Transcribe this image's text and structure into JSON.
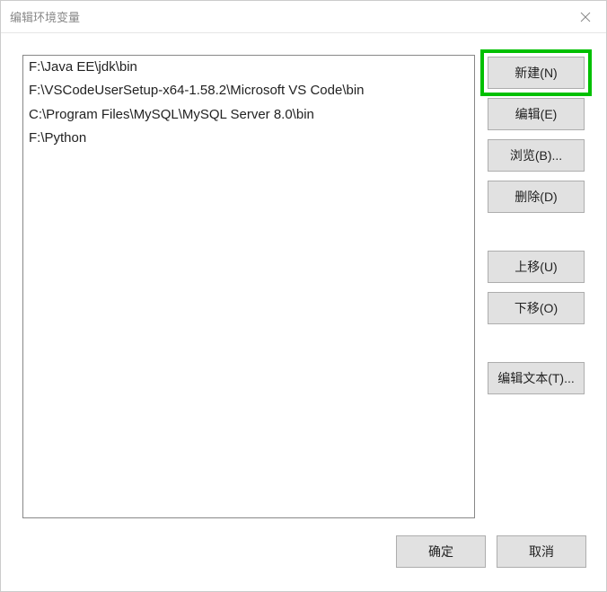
{
  "titlebar": {
    "title": "编辑环境变量"
  },
  "list": {
    "items": [
      "F:\\Java EE\\jdk\\bin",
      "F:\\VSCodeUserSetup-x64-1.58.2\\Microsoft VS Code\\bin",
      "C:\\Program Files\\MySQL\\MySQL Server 8.0\\bin",
      "F:\\Python"
    ]
  },
  "buttons": {
    "new": "新建(N)",
    "edit": "编辑(E)",
    "browse": "浏览(B)...",
    "delete": "删除(D)",
    "moveUp": "上移(U)",
    "moveDown": "下移(O)",
    "editText": "编辑文本(T)...",
    "ok": "确定",
    "cancel": "取消"
  }
}
